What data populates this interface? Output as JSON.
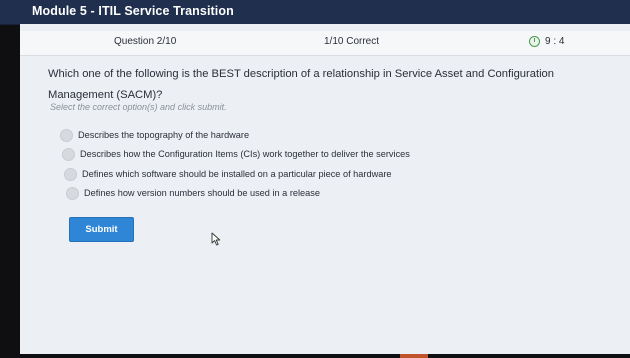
{
  "app": {
    "title": "Module 5 - ITIL Service Transition"
  },
  "status": {
    "question_number": "Question 2/10",
    "correct_count": "1/10 Correct",
    "timer": "9 : 4",
    "timer_icon": "clock-icon"
  },
  "question": {
    "text": "Which one of the following is the BEST description of a relationship in Service Asset and Configuration Management (SACM)?",
    "instruction": "Select the correct option(s) and click submit."
  },
  "options": [
    {
      "label": "Describes the topography of the hardware"
    },
    {
      "label": "Describes how the Configuration Items (CIs) work together to deliver the services"
    },
    {
      "label": "Defines which software should be installed on a particular piece of hardware"
    },
    {
      "label": "Defines how version numbers should be used in a release"
    }
  ],
  "actions": {
    "submit_label": "Submit"
  },
  "colors": {
    "titlebar": "#1f2f4d",
    "submit": "#2f86d6",
    "timer_icon": "#4a9a52"
  }
}
